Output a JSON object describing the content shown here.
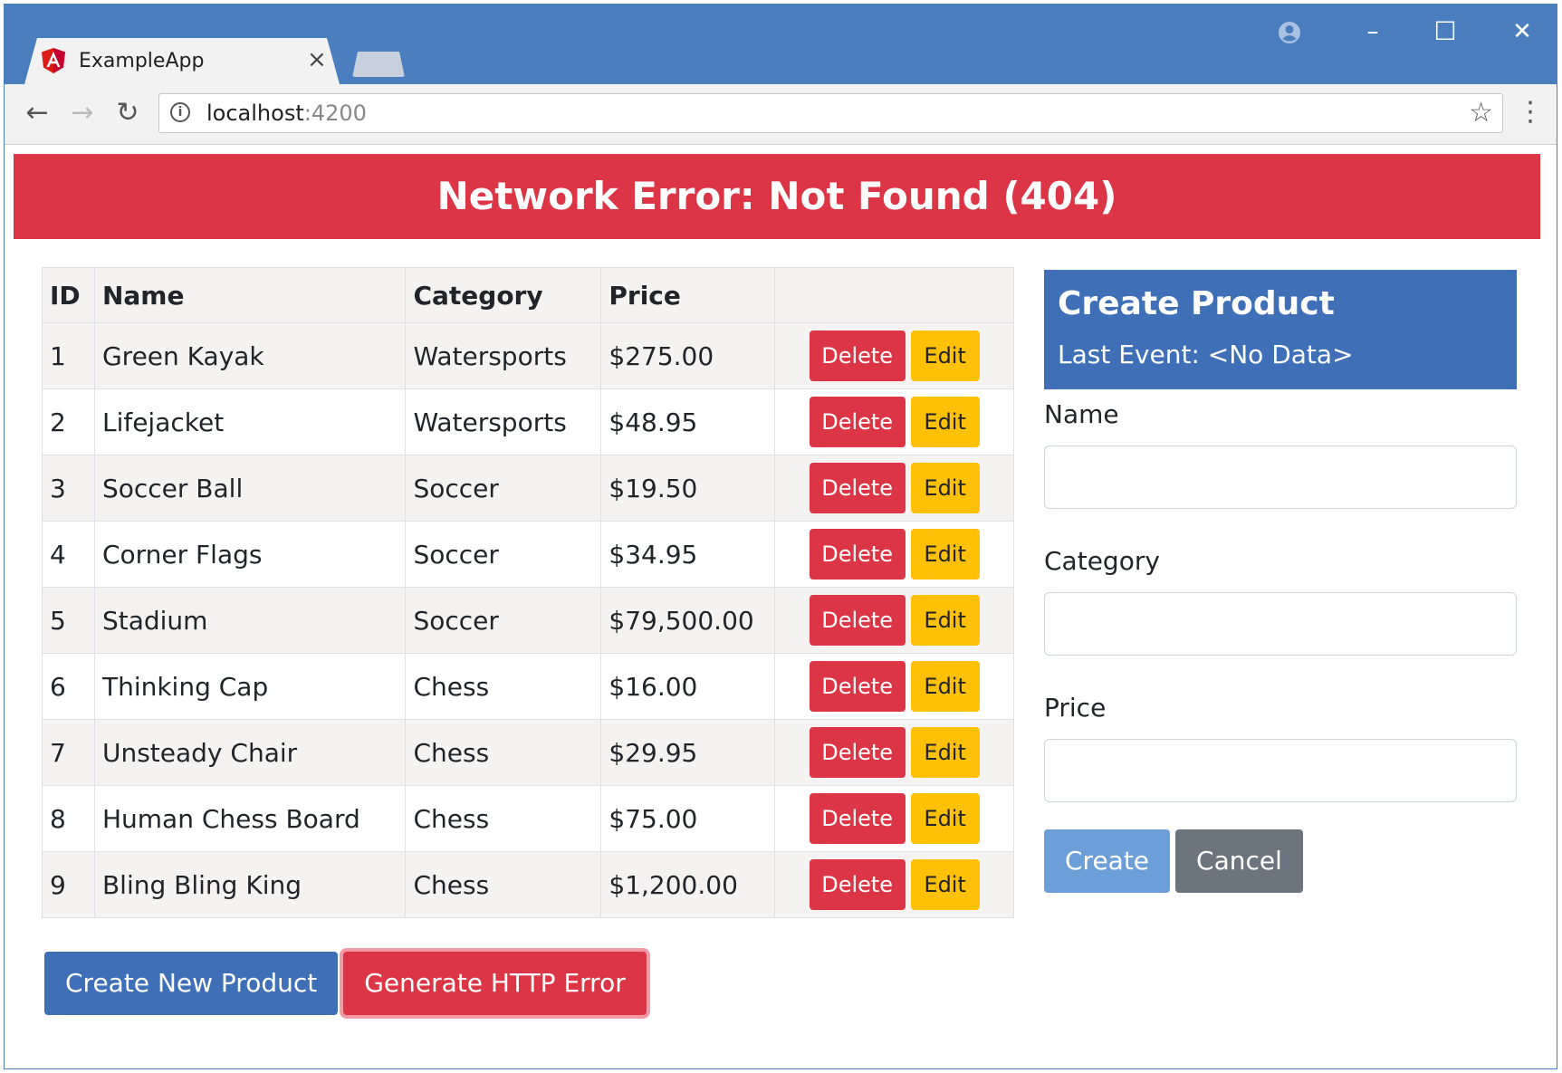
{
  "browser": {
    "tab_title": "ExampleApp",
    "tab_close": "×",
    "url_host": "localhost",
    "url_port": ":4200"
  },
  "window_controls": {
    "account": "account-icon",
    "minimize": "–",
    "maximize": "☐",
    "close": "✕"
  },
  "error_banner": "Network Error: Not Found (404)",
  "table": {
    "headers": [
      "ID",
      "Name",
      "Category",
      "Price",
      ""
    ],
    "rows": [
      {
        "id": "1",
        "name": "Green Kayak",
        "category": "Watersports",
        "price": "$275.00"
      },
      {
        "id": "2",
        "name": "Lifejacket",
        "category": "Watersports",
        "price": "$48.95"
      },
      {
        "id": "3",
        "name": "Soccer Ball",
        "category": "Soccer",
        "price": "$19.50"
      },
      {
        "id": "4",
        "name": "Corner Flags",
        "category": "Soccer",
        "price": "$34.95"
      },
      {
        "id": "5",
        "name": "Stadium",
        "category": "Soccer",
        "price": "$79,500.00"
      },
      {
        "id": "6",
        "name": "Thinking Cap",
        "category": "Chess",
        "price": "$16.00"
      },
      {
        "id": "7",
        "name": "Unsteady Chair",
        "category": "Chess",
        "price": "$29.95"
      },
      {
        "id": "8",
        "name": "Human Chess Board",
        "category": "Chess",
        "price": "$75.00"
      },
      {
        "id": "9",
        "name": "Bling Bling King",
        "category": "Chess",
        "price": "$1,200.00"
      }
    ],
    "delete_label": "Delete",
    "edit_label": "Edit"
  },
  "bottom_buttons": {
    "create_new": "Create New Product",
    "generate_error": "Generate HTTP Error"
  },
  "form": {
    "title": "Create Product",
    "last_event": "Last Event: <No Data>",
    "name_label": "Name",
    "name_value": "",
    "category_label": "Category",
    "category_value": "",
    "price_label": "Price",
    "price_value": "",
    "create_label": "Create",
    "cancel_label": "Cancel"
  },
  "colors": {
    "chrome_blue": "#4a7ebf",
    "danger": "#dc3545",
    "warning": "#ffc107",
    "primary": "#3f6fb7",
    "secondary": "#6c757d"
  }
}
